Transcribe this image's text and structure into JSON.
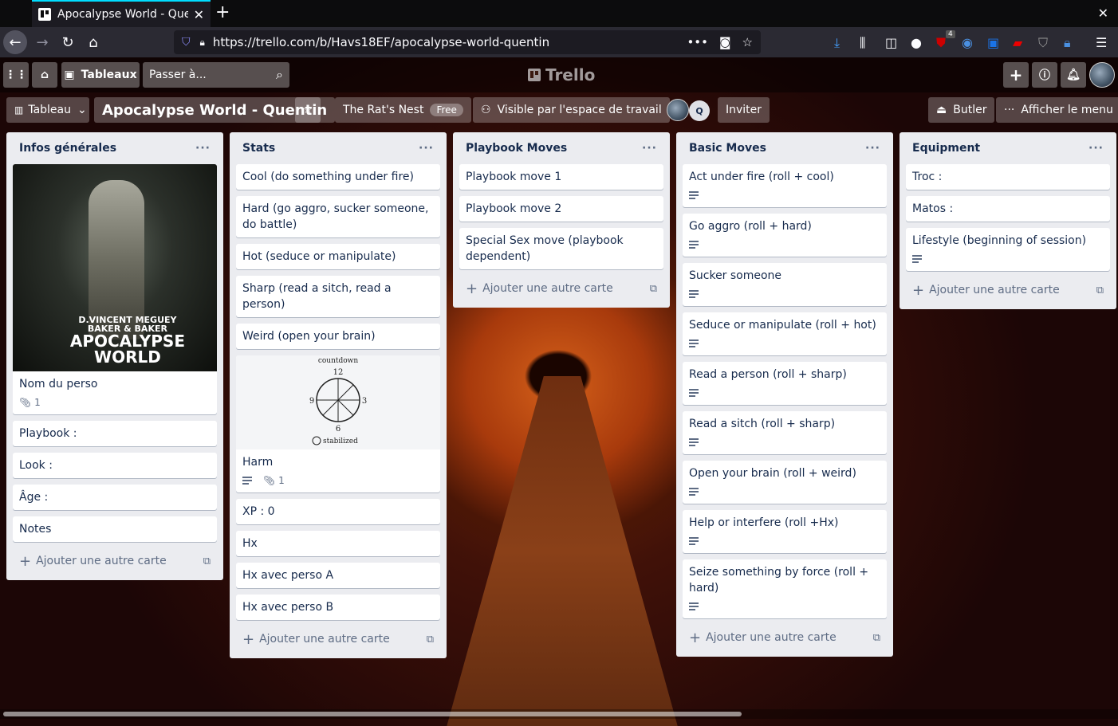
{
  "browser": {
    "tab_title": "Apocalypse World - Quentin",
    "url": "https://trello.com/b/Havs18EF/apocalypse-world-quentin",
    "ext_badge": "4"
  },
  "topbar": {
    "boards_label": "Tableaux",
    "search_placeholder": "Passer à...",
    "logo_text": "Trello"
  },
  "boardbar": {
    "view_label": "Tableau",
    "board_title": "Apocalypse World - Quentin",
    "workspace_name": "The Rat's Nest",
    "workspace_badge": "Free",
    "visibility_label": "Visible par l'espace de travail",
    "member_initial": "Q",
    "invite_label": "Inviter",
    "butler_label": "Butler",
    "menu_label": "Afficher le menu"
  },
  "add_card_label": "Ajouter une autre carte",
  "cover": {
    "line1": "D.VINCENT  MEGUEY",
    "line2": "BAKER & BAKER",
    "line3": "APOCALYPSE",
    "line4": "WORLD"
  },
  "countdown": {
    "title": "countdown",
    "n12": "12",
    "n3": "3",
    "n6": "6",
    "n9": "9",
    "stabilized": "stabilized"
  },
  "lists": [
    {
      "title": "Infos générales",
      "cards": [
        {
          "title": "Nom du perso",
          "attachments": "1"
        },
        {
          "title": "Playbook :"
        },
        {
          "title": "Look :"
        },
        {
          "title": "Âge :"
        },
        {
          "title": "Notes"
        }
      ]
    },
    {
      "title": "Stats",
      "cards": [
        {
          "title": "Cool (do something under fire)"
        },
        {
          "title": "Hard (go aggro, sucker someone, do battle)"
        },
        {
          "title": "Hot (seduce or manipulate)"
        },
        {
          "title": "Sharp (read a sitch, read a person)"
        },
        {
          "title": "Weird (open your brain)"
        },
        {
          "title": "Harm",
          "attachments": "1"
        },
        {
          "title": "XP : 0"
        },
        {
          "title": "Hx"
        },
        {
          "title": "Hx avec perso A"
        },
        {
          "title": "Hx avec perso B"
        }
      ]
    },
    {
      "title": "Playbook Moves",
      "cards": [
        {
          "title": "Playbook move 1"
        },
        {
          "title": "Playbook move 2"
        },
        {
          "title": "Special Sex move (playbook dependent)"
        }
      ]
    },
    {
      "title": "Basic Moves",
      "cards": [
        {
          "title": "Act under fire (roll + cool)"
        },
        {
          "title": "Go aggro (roll + hard)"
        },
        {
          "title": "Sucker someone"
        },
        {
          "title": "Seduce or manipulate (roll + hot)"
        },
        {
          "title": "Read a person (roll + sharp)"
        },
        {
          "title": "Read a sitch (roll + sharp)"
        },
        {
          "title": "Open your brain (roll + weird)"
        },
        {
          "title": "Help or interfere (roll +Hx)"
        },
        {
          "title": "Seize something by force (roll + hard)"
        }
      ]
    },
    {
      "title": "Equipment",
      "cards": [
        {
          "title": "Troc :"
        },
        {
          "title": "Matos :"
        },
        {
          "title": "Lifestyle (beginning of session)"
        }
      ]
    }
  ]
}
